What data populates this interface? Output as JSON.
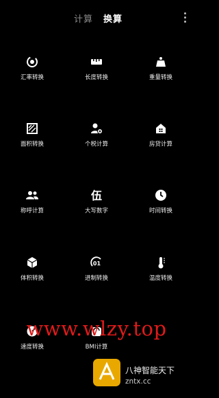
{
  "header": {
    "tab_calc": "计算",
    "tab_convert": "换算"
  },
  "grid": [
    {
      "label": "汇率转换",
      "icon": "currency-exchange-icon"
    },
    {
      "label": "长度转换",
      "icon": "ruler-icon"
    },
    {
      "label": "重量转换",
      "icon": "weight-icon"
    },
    {
      "label": "面积转换",
      "icon": "area-icon"
    },
    {
      "label": "个税计算",
      "icon": "person-tax-icon"
    },
    {
      "label": "房贷计算",
      "icon": "house-loan-icon"
    },
    {
      "label": "称呼计算",
      "icon": "people-icon"
    },
    {
      "label": "大写数字",
      "icon": "capital-number-icon"
    },
    {
      "label": "时间转换",
      "icon": "clock-icon"
    },
    {
      "label": "体积转换",
      "icon": "cube-icon"
    },
    {
      "label": "进制转换",
      "icon": "binary-icon"
    },
    {
      "label": "温度转换",
      "icon": "thermometer-icon"
    },
    {
      "label": "速度转换",
      "icon": "speed-icon"
    },
    {
      "label": "BMI计算",
      "icon": "bmi-scale-icon"
    }
  ],
  "overlay": {
    "watermark": "www.wlzy.top",
    "logo_title": "八神智能天下",
    "logo_url": "zntx.cc"
  }
}
